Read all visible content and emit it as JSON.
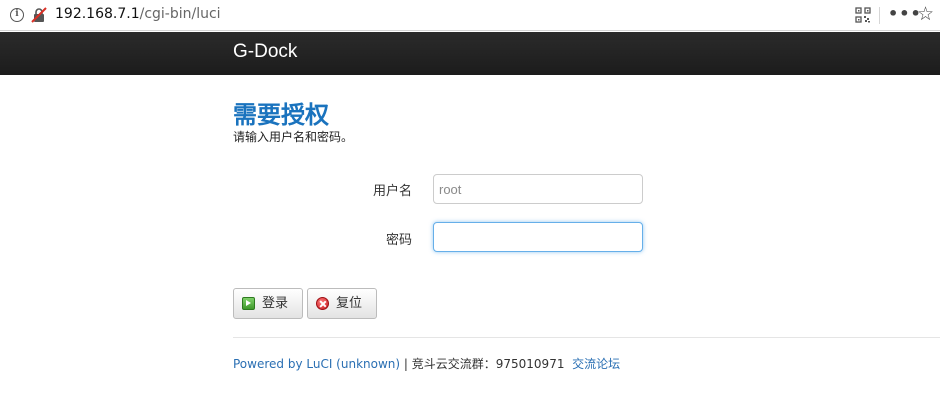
{
  "browser": {
    "url_host": "192.168.7.1",
    "url_path": "/cgi-bin/luci",
    "icons": [
      "info-icon",
      "insecure-lock-icon",
      "qr-code-icon",
      "more-icon",
      "star-icon"
    ]
  },
  "header": {
    "brand": "G-Dock",
    "background": "#222222"
  },
  "main": {
    "title": "需要授权",
    "description": "请输入用户名和密码。",
    "title_color": "#1a73be"
  },
  "form": {
    "username_label": "用户名",
    "username_placeholder": "root",
    "username_value": "",
    "password_label": "密码",
    "password_value": ""
  },
  "buttons": {
    "login": "登录",
    "reset": "复位"
  },
  "footer": {
    "powered_by": "Powered by LuCI (unknown)",
    "separator": " | ",
    "group_text": "竞斗云交流群：975010971",
    "forum_link": "交流论坛",
    "link_color": "#2a6fb3"
  }
}
